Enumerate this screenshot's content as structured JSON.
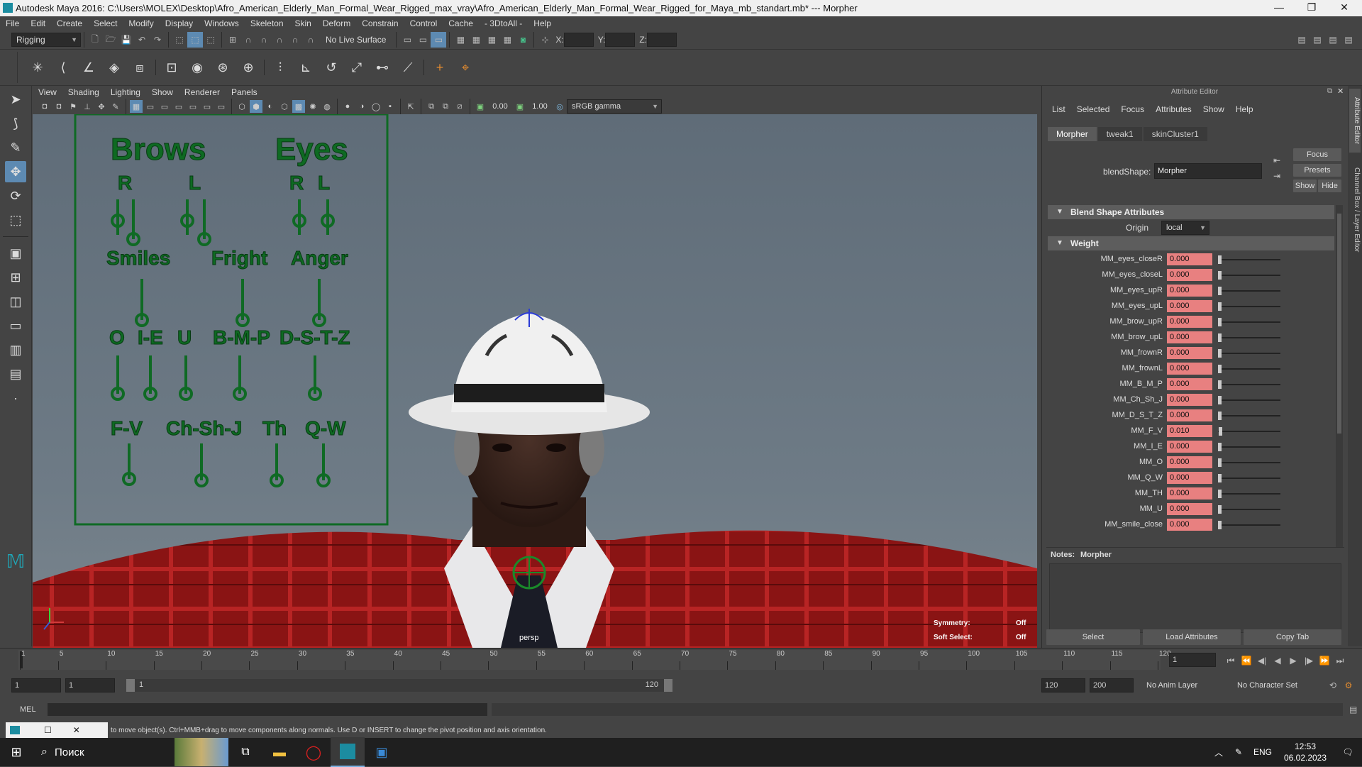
{
  "window": {
    "title": "Autodesk Maya 2016: C:\\Users\\MOLEX\\Desktop\\Afro_American_Elderly_Man_Formal_Wear_Rigged_max_vray\\Afro_American_Elderly_Man_Formal_Wear_Rigged_for_Maya_mb_standart.mb*  ---  Morpher",
    "minimize": "—",
    "maximize": "❐",
    "close": "✕"
  },
  "menubar": [
    "File",
    "Edit",
    "Create",
    "Select",
    "Modify",
    "Display",
    "Windows",
    "Skeleton",
    "Skin",
    "Deform",
    "Constrain",
    "Control",
    "Cache",
    "- 3DtoAll -",
    "Help"
  ],
  "statusline": {
    "menuset": "Rigging",
    "live_surface": "No Live Surface",
    "x_label": "X:",
    "y_label": "Y:",
    "z_label": "Z:"
  },
  "viewport": {
    "menu": [
      "View",
      "Shading",
      "Lighting",
      "Show",
      "Renderer",
      "Panels"
    ],
    "exposure": "0.00",
    "gamma": "1.00",
    "color_space": "sRGB gamma",
    "camera": "persp",
    "symmetry_label": "Symmetry:",
    "symmetry_value": "Off",
    "soft_select_label": "Soft Select:",
    "soft_select_value": "Off",
    "panel_labels": {
      "brows": "Brows",
      "eyes": "Eyes",
      "r1": "R",
      "l1": "L",
      "r2": "R",
      "l2": "L",
      "smiles": "Smiles",
      "fright": "Fright",
      "anger": "Anger",
      "o": "O",
      "ie": "I-E",
      "u": "U",
      "bmp": "B-M-P",
      "dstz": "D-S-T-Z",
      "fv": "F-V",
      "chshj": "Ch-Sh-J",
      "th": "Th",
      "qw": "Q-W"
    }
  },
  "attribute_editor": {
    "title": "Attribute Editor",
    "menu": [
      "List",
      "Selected",
      "Focus",
      "Attributes",
      "Show",
      "Help"
    ],
    "tabs": [
      "Morpher",
      "tweak1",
      "skinCluster1"
    ],
    "blendshape_label": "blendShape:",
    "blendshape_value": "Morpher",
    "focus_btn": "Focus",
    "presets_btn": "Presets",
    "show_btn": "Show",
    "hide_btn": "Hide",
    "section_blend": "Blend Shape Attributes",
    "origin_label": "Origin",
    "origin_value": "local",
    "section_weight": "Weight",
    "weights": [
      {
        "label": "MM_eyes_closeR",
        "value": "0.000",
        "fraction": 0.0
      },
      {
        "label": "MM_eyes_closeL",
        "value": "0.000",
        "fraction": 0.0
      },
      {
        "label": "MM_eyes_upR",
        "value": "0.000",
        "fraction": 0.0
      },
      {
        "label": "MM_eyes_upL",
        "value": "0.000",
        "fraction": 0.0
      },
      {
        "label": "MM_brow_upR",
        "value": "0.000",
        "fraction": 0.0
      },
      {
        "label": "MM_brow_upL",
        "value": "0.000",
        "fraction": 0.0
      },
      {
        "label": "MM_frownR",
        "value": "0.000",
        "fraction": 0.0
      },
      {
        "label": "MM_frownL",
        "value": "0.000",
        "fraction": 0.0
      },
      {
        "label": "MM_B_M_P",
        "value": "0.000",
        "fraction": 0.0
      },
      {
        "label": "MM_Ch_Sh_J",
        "value": "0.000",
        "fraction": 0.0
      },
      {
        "label": "MM_D_S_T_Z",
        "value": "0.000",
        "fraction": 0.0
      },
      {
        "label": "MM_F_V",
        "value": "0.010",
        "fraction": 0.01
      },
      {
        "label": "MM_I_E",
        "value": "0.000",
        "fraction": 0.0
      },
      {
        "label": "MM_O",
        "value": "0.000",
        "fraction": 0.0
      },
      {
        "label": "MM_Q_W",
        "value": "0.000",
        "fraction": 0.0
      },
      {
        "label": "MM_TH",
        "value": "0.000",
        "fraction": 0.0
      },
      {
        "label": "MM_U",
        "value": "0.000",
        "fraction": 0.0
      },
      {
        "label": "MM_smile_close",
        "value": "0.000",
        "fraction": 0.0
      }
    ],
    "notes_label": "Notes:",
    "notes_value": "Morpher",
    "select_btn": "Select",
    "load_btn": "Load Attributes",
    "copy_btn": "Copy Tab",
    "side_tab1": "Attribute Editor",
    "side_tab2": "Channel Box / Layer Editor"
  },
  "timeslider": {
    "ticks": [
      "1",
      "5",
      "10",
      "15",
      "20",
      "25",
      "30",
      "35",
      "40",
      "45",
      "50",
      "55",
      "60",
      "65",
      "70",
      "75",
      "80",
      "85",
      "90",
      "95",
      "100",
      "105",
      "110",
      "115",
      "120"
    ],
    "current_frame": "1"
  },
  "rangeslider": {
    "start": "1",
    "playback_start": "1",
    "bar_start": "1",
    "bar_end": "120",
    "playback_end": "120",
    "end": "200",
    "anim_layer": "No Anim Layer",
    "character_set": "No Character Set"
  },
  "cmdline": {
    "label": "MEL"
  },
  "helpline": {
    "text": "to move object(s). Ctrl+MMB+drag to move components along normals. Use D or INSERT to change the pivot position and axis orientation."
  },
  "taskbar": {
    "search": "Поиск",
    "lang": "ENG",
    "time": "12:53",
    "date": "06.02.2023"
  }
}
